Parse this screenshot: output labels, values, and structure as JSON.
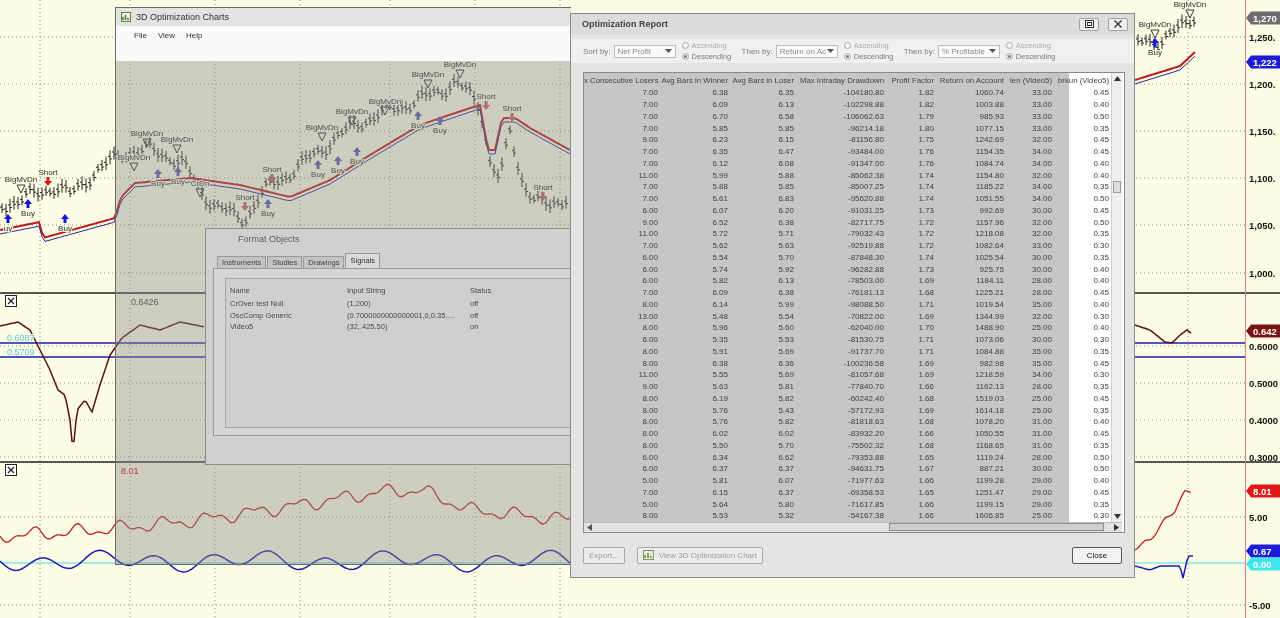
{
  "chart": {
    "price_axis": [
      "1,250.",
      "1,200.",
      "1,150.",
      "1,100.",
      "1,050.",
      "1,000."
    ],
    "price_tags": [
      {
        "text": "1,270",
        "color": "#6e6e6e"
      },
      {
        "text": "1,222",
        "color": "#1c1cd6"
      }
    ],
    "signals": [
      {
        "kind": "triangle",
        "label": "BigMvDn"
      },
      {
        "kind": "short",
        "label": "Short"
      },
      {
        "kind": "buy",
        "label": "Buy"
      },
      {
        "kind": "buy",
        "label": "uy"
      },
      {
        "kind": "buy",
        "label": "Buy"
      },
      {
        "kind": "triangle",
        "label": "BigMvDn"
      },
      {
        "kind": "triangle",
        "label": "BigMvDn"
      },
      {
        "kind": "triangle",
        "label": "BigMvDn"
      },
      {
        "kind": "buy",
        "label": "Buy"
      },
      {
        "kind": "buy",
        "label": "Buy"
      },
      {
        "kind": "triangle",
        "label": "CrDn"
      },
      {
        "kind": "short",
        "label": "Short"
      },
      {
        "kind": "short",
        "label": "Short"
      },
      {
        "kind": "buy",
        "label": "Buy"
      },
      {
        "kind": "triangle",
        "label": "BigMvDn"
      },
      {
        "kind": "triangle",
        "label": "BigMvDn"
      },
      {
        "kind": "triangle",
        "label": "BigMvDn"
      },
      {
        "kind": "buy",
        "label": "Buy"
      },
      {
        "kind": "buy",
        "label": "Buy"
      },
      {
        "kind": "buy",
        "label": "Buy"
      },
      {
        "kind": "triangle",
        "label": "BigMvDn"
      },
      {
        "kind": "triangle",
        "label": "BigMvDn"
      },
      {
        "kind": "buy",
        "label": "Buy"
      },
      {
        "kind": "buy",
        "label": "Buy"
      },
      {
        "kind": "short",
        "label": "Short"
      },
      {
        "kind": "short",
        "label": "Short"
      },
      {
        "kind": "short",
        "label": "Short"
      },
      {
        "kind": "triangle",
        "label": "BigMvDn"
      },
      {
        "kind": "buy",
        "label": "Buy"
      },
      {
        "kind": "triangle",
        "label": "BigMvDn"
      }
    ],
    "oscillator": {
      "reading": "0.6426",
      "level_labels": [
        "0.6087",
        "0.5709"
      ],
      "axis": [
        "0.6000",
        "0.5000",
        "0.4000",
        "0.3000"
      ],
      "tags": [
        {
          "text": "0.642",
          "color": "#7a1414"
        }
      ]
    },
    "indicator": {
      "reading": "8.01",
      "axis": [
        "5.00",
        "-5.00"
      ],
      "tags": [
        {
          "text": "8.01",
          "color": "#e01818"
        },
        {
          "text": "0.67",
          "color": "#1c1cd6"
        },
        {
          "text": "0.00",
          "color": "#3ee6ee"
        }
      ]
    }
  },
  "optimization_window": {
    "title": "3D Optimization Charts",
    "menu": [
      "File",
      "View",
      "Help"
    ]
  },
  "format_objects": {
    "title": "Format Objects",
    "tabs": [
      {
        "label": "Instruments",
        "selected": false
      },
      {
        "label": "Studies",
        "selected": false
      },
      {
        "label": "Drawings",
        "selected": false
      },
      {
        "label": "Signals",
        "selected": true
      }
    ],
    "columns": [
      "Name",
      "Input String",
      "Status"
    ],
    "rows": [
      [
        "CrOver test Null",
        "(1,200)",
        "off"
      ],
      [
        "OscComp Generic",
        "(0.7000000000000001,0,0.35,…",
        "off"
      ],
      [
        "Video5",
        "(32,.425,50)",
        "on"
      ]
    ]
  },
  "report": {
    "title": "Optimization Report",
    "sort": [
      {
        "label": "Sort by:",
        "value": "Net Profit",
        "options": [
          {
            "label": "Ascending",
            "selected": false
          },
          {
            "label": "Descending",
            "selected": true
          }
        ]
      },
      {
        "label": "Then by:",
        "value": "Return on Ac",
        "options": [
          {
            "label": "Ascending",
            "selected": false
          },
          {
            "label": "Descending",
            "selected": true
          }
        ]
      },
      {
        "label": "Then by:",
        "value": "% Profitable",
        "options": [
          {
            "label": "Ascending",
            "selected": false
          },
          {
            "label": "Descending",
            "selected": true
          }
        ]
      }
    ],
    "columns": [
      "x Consecutive Losers",
      "Avg Bars in Winner",
      "Avg Bars in Loser",
      "Max Intraday Drawdown",
      "Profit Factor",
      "Return on Account",
      "len (Video5)",
      "brkun (Video5)"
    ],
    "rows": [
      [
        "7.00",
        "6.38",
        "6.35",
        "-104180.80",
        "1.82",
        "1060.74",
        "33.00",
        "0.45"
      ],
      [
        "7.00",
        "6.09",
        "6.13",
        "-102298.88",
        "1.82",
        "1003.88",
        "33.00",
        "0.40"
      ],
      [
        "7.00",
        "6.70",
        "6.58",
        "-106062.63",
        "1.79",
        "985.93",
        "33.00",
        "0.50"
      ],
      [
        "7.00",
        "5.85",
        "5.85",
        "-96214.18",
        "1.80",
        "1077.15",
        "33.00",
        "0.35"
      ],
      [
        "9.00",
        "6.23",
        "6.15",
        "-81156.80",
        "1.75",
        "1242.69",
        "32.00",
        "0.45"
      ],
      [
        "7.00",
        "6.35",
        "6.47",
        "-93484.00",
        "1.76",
        "1154.35",
        "34.00",
        "0.45"
      ],
      [
        "7.00",
        "6.12",
        "6.08",
        "-91347.00",
        "1.76",
        "1084.74",
        "34.00",
        "0.40"
      ],
      [
        "11.00",
        "5.99",
        "5.88",
        "-85062.38",
        "1.74",
        "1154.80",
        "32.00",
        "0.40"
      ],
      [
        "7.00",
        "5.88",
        "5.85",
        "-85007.25",
        "1.74",
        "1185.22",
        "34.00",
        "0.35"
      ],
      [
        "7.00",
        "6.61",
        "6.83",
        "-95620.88",
        "1.74",
        "1051.55",
        "34.00",
        "0.50"
      ],
      [
        "6.00",
        "6.07",
        "6.20",
        "-91031.25",
        "1.73",
        "992.69",
        "30.00",
        "0.45"
      ],
      [
        "9.00",
        "6.52",
        "6.38",
        "-82717.75",
        "1.72",
        "1157.96",
        "32.00",
        "0.50"
      ],
      [
        "11.00",
        "5.72",
        "5.71",
        "-79032.43",
        "1.72",
        "1218.08",
        "32.00",
        "0.35"
      ],
      [
        "7.00",
        "5.62",
        "5.63",
        "-92519.88",
        "1.72",
        "1082.64",
        "33.00",
        "0.30"
      ],
      [
        "6.00",
        "5.54",
        "5.70",
        "-87848.30",
        "1.74",
        "1025.54",
        "30.00",
        "0.35"
      ],
      [
        "6.00",
        "5.74",
        "5.92",
        "-96282.88",
        "1.73",
        "925.75",
        "30.00",
        "0.40"
      ],
      [
        "6.00",
        "5.82",
        "6.13",
        "-78503.00",
        "1.69",
        "1184.11",
        "28.00",
        "0.40"
      ],
      [
        "7.00",
        "6.09",
        "6.38",
        "-76181.13",
        "1.68",
        "1225.21",
        "28.00",
        "0.45"
      ],
      [
        "8.00",
        "6.14",
        "5.99",
        "-98088.50",
        "1.71",
        "1019.54",
        "35.00",
        "0.40"
      ],
      [
        "13.00",
        "5.48",
        "5.54",
        "-70822.00",
        "1.69",
        "1344.99",
        "32.00",
        "0.30"
      ],
      [
        "8.00",
        "5.96",
        "5.60",
        "-62040.00",
        "1.70",
        "1488.90",
        "25.00",
        "0.40"
      ],
      [
        "6.00",
        "5.35",
        "5.53",
        "-81530.75",
        "1.71",
        "1073.06",
        "30.00",
        "0.30"
      ],
      [
        "8.00",
        "5.91",
        "5.69",
        "-91737.70",
        "1.71",
        "1084.88",
        "35.00",
        "0.35"
      ],
      [
        "8.00",
        "6.38",
        "6.36",
        "-100236.58",
        "1.69",
        "982.98",
        "35.00",
        "0.45"
      ],
      [
        "11.00",
        "5.55",
        "5.69",
        "-81057.68",
        "1.69",
        "1218.59",
        "34.00",
        "0.30"
      ],
      [
        "9.00",
        "5.63",
        "5.81",
        "-77840.70",
        "1.66",
        "1162.13",
        "28.00",
        "0.35"
      ],
      [
        "8.00",
        "6.19",
        "5.82",
        "-60242.40",
        "1.68",
        "1519.03",
        "25.00",
        "0.45"
      ],
      [
        "8.00",
        "5.76",
        "5.43",
        "-57172.93",
        "1.69",
        "1614.18",
        "25.00",
        "0.35"
      ],
      [
        "8.00",
        "5.76",
        "5.82",
        "-81818.63",
        "1.68",
        "1078.20",
        "31.00",
        "0.40"
      ],
      [
        "8.00",
        "6.02",
        "6.02",
        "-83932.20",
        "1.66",
        "1050.55",
        "31.00",
        "0.45"
      ],
      [
        "8.00",
        "5.50",
        "5.70",
        "-75502.32",
        "1.68",
        "1168.65",
        "31.00",
        "0.35"
      ],
      [
        "6.00",
        "6.34",
        "6.62",
        "-79353.88",
        "1.65",
        "1119.24",
        "28.00",
        "0.50"
      ],
      [
        "6.00",
        "6.37",
        "6.37",
        "-94631.75",
        "1.67",
        "887.21",
        "30.00",
        "0.50"
      ],
      [
        "5.00",
        "5.81",
        "6.07",
        "-71977.63",
        "1.66",
        "1199.28",
        "29.00",
        "0.40"
      ],
      [
        "7.00",
        "6.15",
        "6.37",
        "-69358.53",
        "1.65",
        "1251.47",
        "29.00",
        "0.45"
      ],
      [
        "5.00",
        "5.64",
        "5.80",
        "-71617.85",
        "1.66",
        "1199.15",
        "29.00",
        "0.35"
      ],
      [
        "8.00",
        "5.53",
        "5.32",
        "-54167.38",
        "1.66",
        "1606.85",
        "25.00",
        "0.30"
      ]
    ],
    "buttons": {
      "export": "Export...",
      "view_chart": "View 3D Optimization Chart",
      "close": "Close"
    }
  }
}
